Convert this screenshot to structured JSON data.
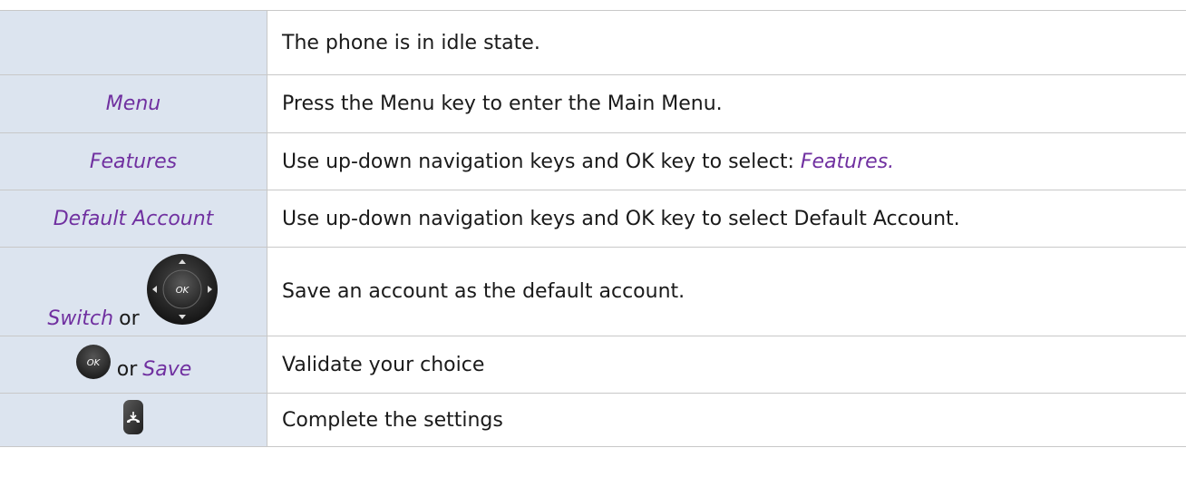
{
  "rows": [
    {
      "key": "",
      "description": "The phone is in idle state."
    },
    {
      "key": "Menu",
      "description": "Press the Menu key to enter the Main Menu."
    },
    {
      "key": "Features",
      "description_prefix": "Use up-down navigation keys and OK key to select: ",
      "description_accent": "Features."
    },
    {
      "key": "Default Account",
      "description": "Use up-down navigation keys and OK key to select Default Account."
    },
    {
      "key": "Switch",
      "key_connector": "or",
      "key_icon": "navigation-pad-icon",
      "description": "Save an account as the default account."
    },
    {
      "key_icon": "ok-key-icon",
      "key_connector": "or",
      "key": "Save",
      "description": "Validate your choice"
    },
    {
      "key_icon": "hang-up-key-icon",
      "description": "Complete the settings"
    }
  ],
  "colors": {
    "key_column_bg": "#dce4ef",
    "accent": "#7030a0",
    "border": "#c8c8c8"
  },
  "icons": {
    "nav_pad_label": "OK",
    "ok_key_label": "OK"
  }
}
